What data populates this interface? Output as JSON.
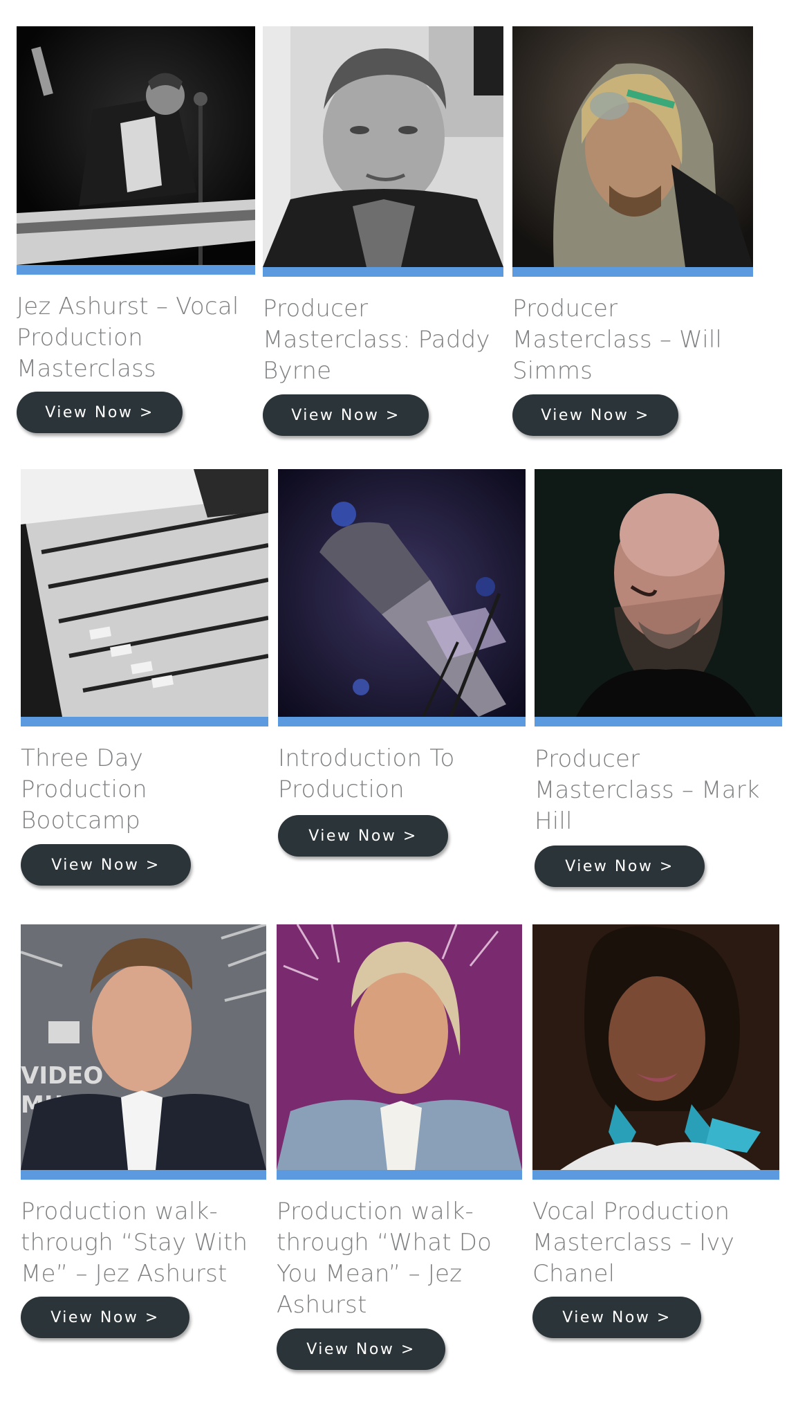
{
  "courses": [
    {
      "title_lines": [
        "Jez Ashurst – Vocal",
        "Production",
        "Masterclass"
      ],
      "button_label": "View Now >",
      "image": "photo-singer-guitar"
    },
    {
      "title_lines": [
        "Producer",
        "Masterclass: Paddy",
        "Byrne"
      ],
      "button_label": "View Now >",
      "image": "photo-paddy-byrne"
    },
    {
      "title_lines": [
        "Producer",
        "Masterclass – Will",
        "Simms"
      ],
      "button_label": "View Now >",
      "image": "photo-will-simms"
    },
    {
      "title_lines": [
        "Three Day",
        "Production",
        "Bootcamp"
      ],
      "button_label": "View Now >",
      "image": "photo-mixing-desk"
    },
    {
      "title_lines": [
        "Introduction To",
        "Production"
      ],
      "button_label": "View Now >",
      "image": "photo-microphone"
    },
    {
      "title_lines": [
        "Producer",
        "Masterclass – Mark",
        "Hill"
      ],
      "button_label": "View Now >",
      "image": "photo-mark-hill"
    },
    {
      "title_lines": [
        "Production walk-",
        "through “Stay With",
        "Me” – Jez Ashurst"
      ],
      "button_label": "View Now >",
      "image": "photo-sam-smith"
    },
    {
      "title_lines": [
        "Production walk-",
        "through “What Do",
        "You Mean” – Jez",
        "Ashurst"
      ],
      "button_label": "View Now >",
      "image": "photo-justin-bieber"
    },
    {
      "title_lines": [
        "Vocal Production",
        "Masterclass – Ivy",
        "Chanel"
      ],
      "button_label": "View Now >",
      "image": "photo-ivy-chanel"
    }
  ],
  "colors": {
    "accent_bar": "#5b9ade",
    "button_bg": "#2b3438",
    "button_text": "#ffffff",
    "title_text": "#7d7f81"
  }
}
